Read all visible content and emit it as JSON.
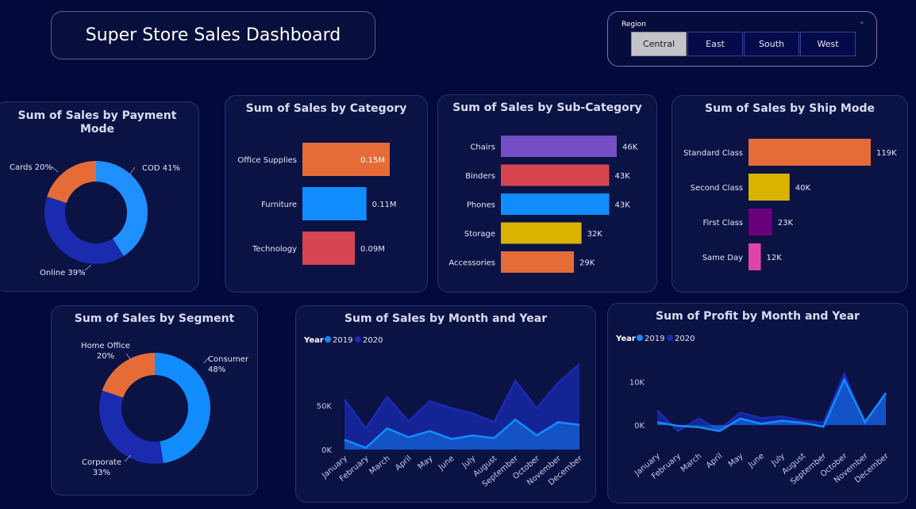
{
  "header": {
    "title": "Super Store Sales Dashboard"
  },
  "region_filter": {
    "label": "Region",
    "options": [
      "Central",
      "East",
      "South",
      "West"
    ],
    "selected": "Central"
  },
  "payment": {
    "title_line1": "Sum of Sales by Payment",
    "title_line2": "Mode",
    "slices": [
      {
        "label": "COD 41%",
        "value": 41,
        "color": "#1e90ff"
      },
      {
        "label": "Online 39%",
        "value": 39,
        "color": "#1a2bb0"
      },
      {
        "label": "Cards 20%",
        "value": 20,
        "color": "#e66c37"
      }
    ]
  },
  "category": {
    "title": "Sum of Sales by Category",
    "bars": [
      {
        "label": "Office Supplies",
        "value": 0.15,
        "text": "0.15M",
        "color": "#e66c37"
      },
      {
        "label": "Furniture",
        "value": 0.11,
        "text": "0.11M",
        "color": "#118dff"
      },
      {
        "label": "Technology",
        "value": 0.09,
        "text": "0.09M",
        "color": "#d64550"
      }
    ]
  },
  "subcategory": {
    "title": "Sum of Sales by Sub-Category",
    "bars": [
      {
        "label": "Chairs",
        "value": 46,
        "text": "46K",
        "color": "#744ec2"
      },
      {
        "label": "Binders",
        "value": 43,
        "text": "43K",
        "color": "#d64550"
      },
      {
        "label": "Phones",
        "value": 43,
        "text": "43K",
        "color": "#118dff"
      },
      {
        "label": "Storage",
        "value": 32,
        "text": "32K",
        "color": "#d9b300"
      },
      {
        "label": "Accessories",
        "value": 29,
        "text": "29K",
        "color": "#e66c37"
      }
    ]
  },
  "shipmode": {
    "title": "Sum of Sales by Ship Mode",
    "bars": [
      {
        "label": "Standard Class",
        "value": 119,
        "text": "119K",
        "color": "#e66c37"
      },
      {
        "label": "Second Class",
        "value": 40,
        "text": "40K",
        "color": "#d9b300"
      },
      {
        "label": "First Class",
        "value": 23,
        "text": "23K",
        "color": "#6b007b"
      },
      {
        "label": "Same Day",
        "value": 12,
        "text": "12K",
        "color": "#e044a7"
      }
    ]
  },
  "segment": {
    "title": "Sum of Sales by Segment",
    "slices": [
      {
        "label1": "Consumer",
        "label2": "48%",
        "value": 48,
        "color": "#118dff"
      },
      {
        "label1": "Corporate",
        "label2": "33%",
        "value": 33,
        "color": "#1a2bb0"
      },
      {
        "label1": "Home Office",
        "label2": "20%",
        "value": 20,
        "color": "#e66c37"
      }
    ]
  },
  "sales_month": {
    "title": "Sum of Sales by Month and Year",
    "legend_title": "Year",
    "months": [
      "January",
      "February",
      "March",
      "April",
      "May",
      "June",
      "July",
      "August",
      "September",
      "October",
      "November",
      "December"
    ],
    "y_ticks": [
      "50K",
      "0K"
    ],
    "series": [
      {
        "name": "2019",
        "color": "#118dff",
        "values": [
          11,
          2,
          24,
          14,
          21,
          12,
          16,
          13,
          34,
          16,
          31,
          28
        ]
      },
      {
        "name": "2020",
        "color": "#1a2bb0",
        "values": [
          57,
          24,
          60,
          32,
          55,
          47,
          41,
          31,
          78,
          47,
          76,
          97
        ]
      }
    ],
    "ylim": [
      0,
      100
    ]
  },
  "profit_month": {
    "title": "Sum of Profit by Month and Year",
    "legend_title": "Year",
    "months": [
      "January",
      "February",
      "March",
      "April",
      "May",
      "June",
      "July",
      "August",
      "September",
      "October",
      "November",
      "December"
    ],
    "y_ticks": [
      "10K",
      "0K"
    ],
    "series": [
      {
        "name": "2019",
        "color": "#118dff",
        "values": [
          0.6,
          -0.2,
          -0.5,
          -1.4,
          1.5,
          0.3,
          1.0,
          0.5,
          -0.4,
          10.5,
          0.7,
          7.3
        ]
      },
      {
        "name": "2020",
        "color": "#1a2bb0",
        "values": [
          3.4,
          -1.4,
          1.5,
          -1.1,
          2.9,
          1.6,
          2.0,
          1.0,
          0.6,
          11.8,
          0.2,
          7.6
        ]
      }
    ],
    "ylim": [
      -2,
      13
    ]
  },
  "colors": {
    "background": "#03093a",
    "card": "#0b1244",
    "card_border": "#2a3170"
  }
}
